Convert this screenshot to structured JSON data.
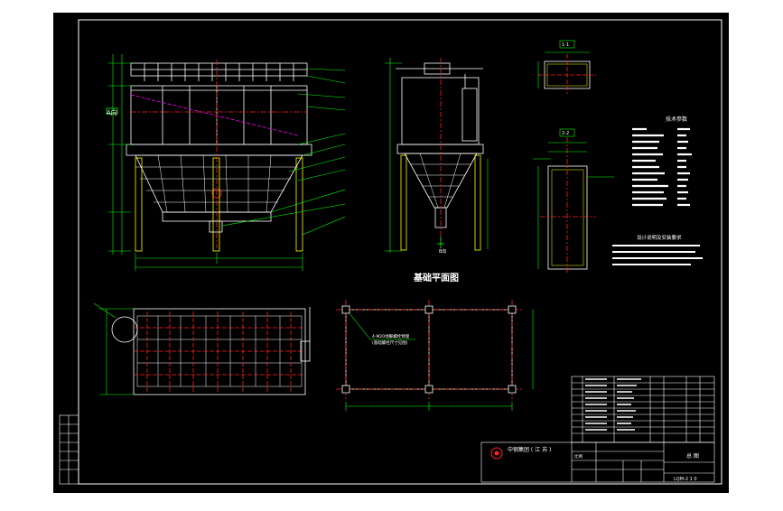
{
  "drawing": {
    "background": "#000000",
    "viewport_bg": "#ffffff",
    "colors": {
      "frame": "#ffffff",
      "structure": "#ffffff",
      "dimension": "#00ff00",
      "centerline": "#ff2020",
      "hidden": "#ff00ff",
      "leader": "#00ff00",
      "weld": "#ffff00"
    }
  },
  "views": {
    "front_side_label": "A向",
    "foundation_title": "基础平面图",
    "section_1_title": "1-1",
    "section_2_title": "2-2",
    "view_b_label": "B向"
  },
  "tech_table": {
    "title": "技术参数"
  },
  "notes": {
    "title": "设计说明及安装要求"
  },
  "foundation": {
    "anchor_note_line1": "4-M20地脚螺栓预埋",
    "anchor_note_line2": "(基础螺栓尺寸见图)"
  },
  "title_block": {
    "company_badge": "中钢集团 ( 江 苏 )",
    "drawing_number": "LQM-2 1 0",
    "scale_label": "比例",
    "product_name": "总 图"
  }
}
